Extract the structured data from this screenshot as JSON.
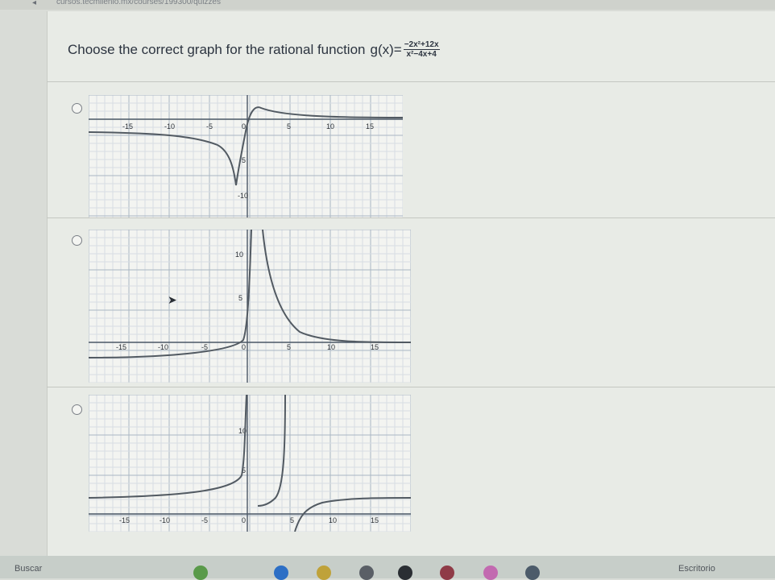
{
  "browser": {
    "url_fragment": "cursos.tecmilenio.mx/courses/199300/quizzes"
  },
  "question": {
    "prompt": "Choose the correct graph for the rational function",
    "function_name": "g(x)=",
    "numerator": "−2x²+12x",
    "denominator": "x²−4x+4"
  },
  "options": [
    {
      "id": "option-a",
      "x_ticks": [
        "-15",
        "-10",
        "-5",
        "0",
        "5",
        "10",
        "15"
      ],
      "y_ticks": [
        "5",
        "-10"
      ]
    },
    {
      "id": "option-b",
      "x_ticks": [
        "-15",
        "-10",
        "-5",
        "0",
        "5",
        "10",
        "15"
      ],
      "y_ticks": [
        "10",
        "5"
      ]
    },
    {
      "id": "option-c",
      "x_ticks": [
        "-15",
        "-10",
        "-5",
        "0",
        "5",
        "10",
        "15"
      ],
      "y_ticks": [
        "10",
        "5"
      ]
    }
  ],
  "taskbar": {
    "left_label": "Buscar",
    "right_label": "Escritorio"
  }
}
